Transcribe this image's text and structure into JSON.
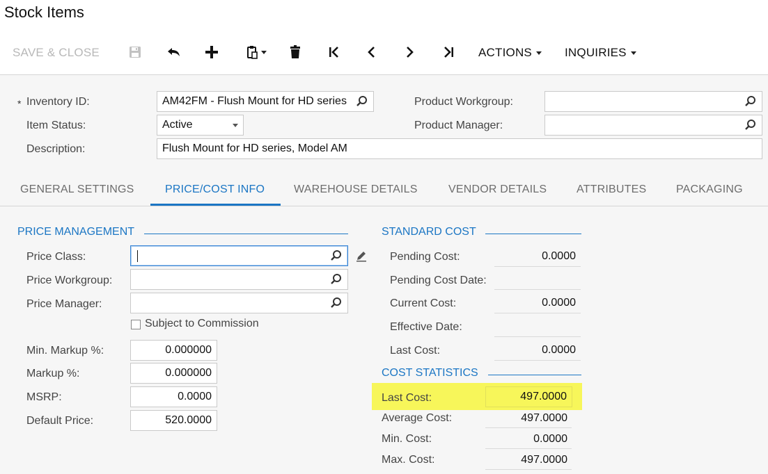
{
  "page": {
    "title": "Stock Items"
  },
  "toolbar": {
    "save_close": "SAVE & CLOSE",
    "actions": "ACTIONS",
    "inquiries": "INQUIRIES",
    "icons": [
      "save-icon",
      "undo-icon",
      "add-icon",
      "copy-paste-icon",
      "delete-icon",
      "first-icon",
      "previous-icon",
      "next-icon",
      "last-icon"
    ]
  },
  "header": {
    "required_mark": "*",
    "inventory_id_label": "Inventory ID:",
    "inventory_id_value": "AM42FM - Flush Mount for HD series",
    "item_status_label": "Item Status:",
    "item_status_value": "Active",
    "description_label": "Description:",
    "description_value": "Flush Mount for HD series, Model AM",
    "product_workgroup_label": "Product Workgroup:",
    "product_workgroup_value": "",
    "product_manager_label": "Product Manager:",
    "product_manager_value": ""
  },
  "tabs": [
    {
      "label": "GENERAL SETTINGS",
      "active": false
    },
    {
      "label": "PRICE/COST INFO",
      "active": true
    },
    {
      "label": "WAREHOUSE DETAILS",
      "active": false
    },
    {
      "label": "VENDOR DETAILS",
      "active": false
    },
    {
      "label": "ATTRIBUTES",
      "active": false
    },
    {
      "label": "PACKAGING",
      "active": false
    }
  ],
  "price_management": {
    "title": "PRICE MANAGEMENT",
    "price_class_label": "Price Class:",
    "price_class_value": "",
    "price_workgroup_label": "Price Workgroup:",
    "price_workgroup_value": "",
    "price_manager_label": "Price Manager:",
    "price_manager_value": "",
    "commission_label": "Subject to Commission",
    "commission_checked": false,
    "min_markup_label": "Min. Markup %:",
    "min_markup_value": "0.000000",
    "markup_label": "Markup %:",
    "markup_value": "0.000000",
    "msrp_label": "MSRP:",
    "msrp_value": "0.0000",
    "default_price_label": "Default Price:",
    "default_price_value": "520.0000"
  },
  "standard_cost": {
    "title": "STANDARD COST",
    "pending_cost_label": "Pending Cost:",
    "pending_cost_value": "0.0000",
    "pending_cost_date_label": "Pending Cost Date:",
    "pending_cost_date_value": "",
    "current_cost_label": "Current Cost:",
    "current_cost_value": "0.0000",
    "effective_date_label": "Effective Date:",
    "effective_date_value": "",
    "last_cost_label": "Last Cost:",
    "last_cost_value": "0.0000"
  },
  "cost_statistics": {
    "title": "COST STATISTICS",
    "last_cost_label": "Last Cost:",
    "last_cost_value": "497.0000",
    "average_cost_label": "Average Cost:",
    "average_cost_value": "497.0000",
    "min_cost_label": "Min. Cost:",
    "min_cost_value": "0.0000",
    "max_cost_label": "Max. Cost:",
    "max_cost_value": "497.0000"
  },
  "colors": {
    "accent": "#1b76c4",
    "highlight": "#f7f65a",
    "panel_bg": "#f6f6f6"
  }
}
